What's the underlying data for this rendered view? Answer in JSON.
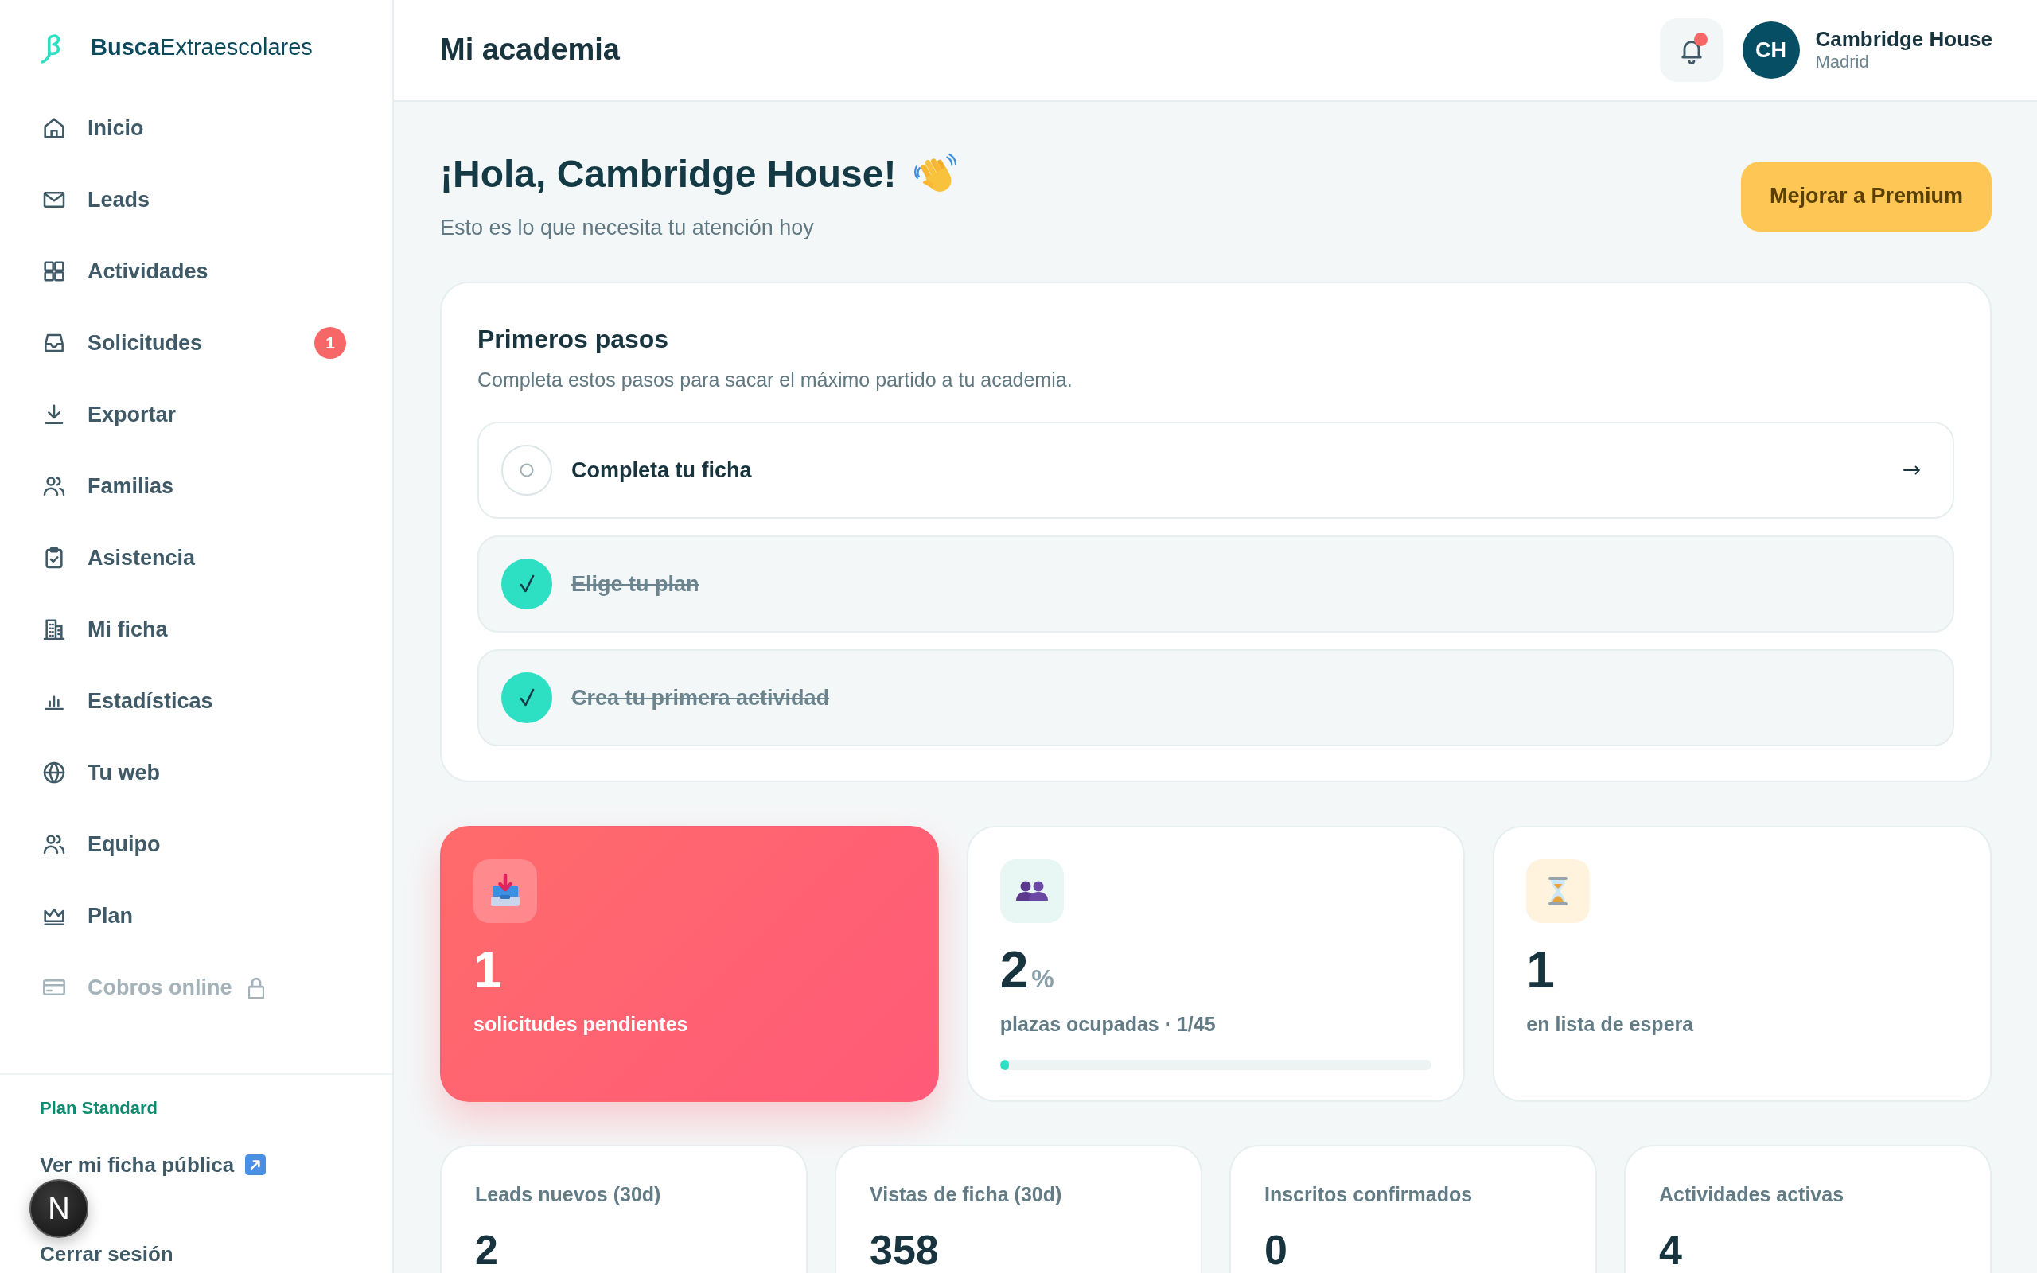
{
  "sidebar": {
    "logo": "**Busca**Extraescolares",
    "items": [
      {
        "label": "Inicio",
        "selected": false,
        "disabled": false
      },
      {
        "label": "Leads",
        "selected": false,
        "disabled": false
      },
      {
        "label": "Actividades",
        "selected": false,
        "disabled": false
      },
      {
        "label": "Solicitudes",
        "badge": "1",
        "selected": false,
        "disabled": false
      },
      {
        "label": "Exportar",
        "selected": false,
        "disabled": false
      },
      {
        "label": "Familias",
        "selected": false,
        "disabled": false
      },
      {
        "label": "Asistencia",
        "selected": false,
        "disabled": false
      },
      {
        "label": "Mi ficha",
        "selected": false,
        "disabled": false
      },
      {
        "label": "Estadísticas",
        "selected": false,
        "disabled": false
      },
      {
        "label": "Tu web",
        "selected": false,
        "disabled": false
      },
      {
        "label": "Equipo",
        "selected": false,
        "disabled": false
      },
      {
        "label": "Plan",
        "selected": false,
        "disabled": false
      },
      {
        "label": "Cobros online",
        "selected": false,
        "disabled": true
      }
    ],
    "plan": "Plan Standard",
    "public_link": "Ver mi ficha pública",
    "logout": "Cerrar sesión"
  },
  "header": {
    "title": "Mi academia",
    "notifications": {
      "unread": true
    },
    "user": {
      "initials": "CH",
      "name": "Cambridge House",
      "city": "Madrid"
    }
  },
  "greeting": {
    "title": "¡Hola, Cambridge House!",
    "subtitle": "Esto es lo que necesita tu atención hoy"
  },
  "upgrade_button": "Mejorar a Premium",
  "onboarding": {
    "title": "Primeros pasos",
    "subtitle": "Completa estos pasos para sacar el máximo partido a tu academia.",
    "steps": [
      {
        "label": "Completa tu ficha",
        "done": false
      },
      {
        "label": "Elige tu plan",
        "done": true
      },
      {
        "label": "Crea tu primera actividad",
        "done": true
      }
    ]
  },
  "stats": [
    {
      "kind": "alert",
      "value": "1",
      "label": "solicitudes pendientes"
    },
    {
      "kind": "capacity",
      "value": "2",
      "unit": "%",
      "label": "plazas ocupadas · 1/45",
      "level": 0.02
    },
    {
      "kind": "plain",
      "value": "1",
      "label": "en lista de espera"
    }
  ],
  "metrics": [
    {
      "label": "Leads nuevos (30d)",
      "value": "2"
    },
    {
      "label": "Vistas de ficha (30d)",
      "value": "358"
    },
    {
      "label": "Inscritos confirmados",
      "value": "0"
    },
    {
      "label": "Actividades activas",
      "value": "4"
    }
  ],
  "dev_indicator": {
    "label": "N"
  }
}
